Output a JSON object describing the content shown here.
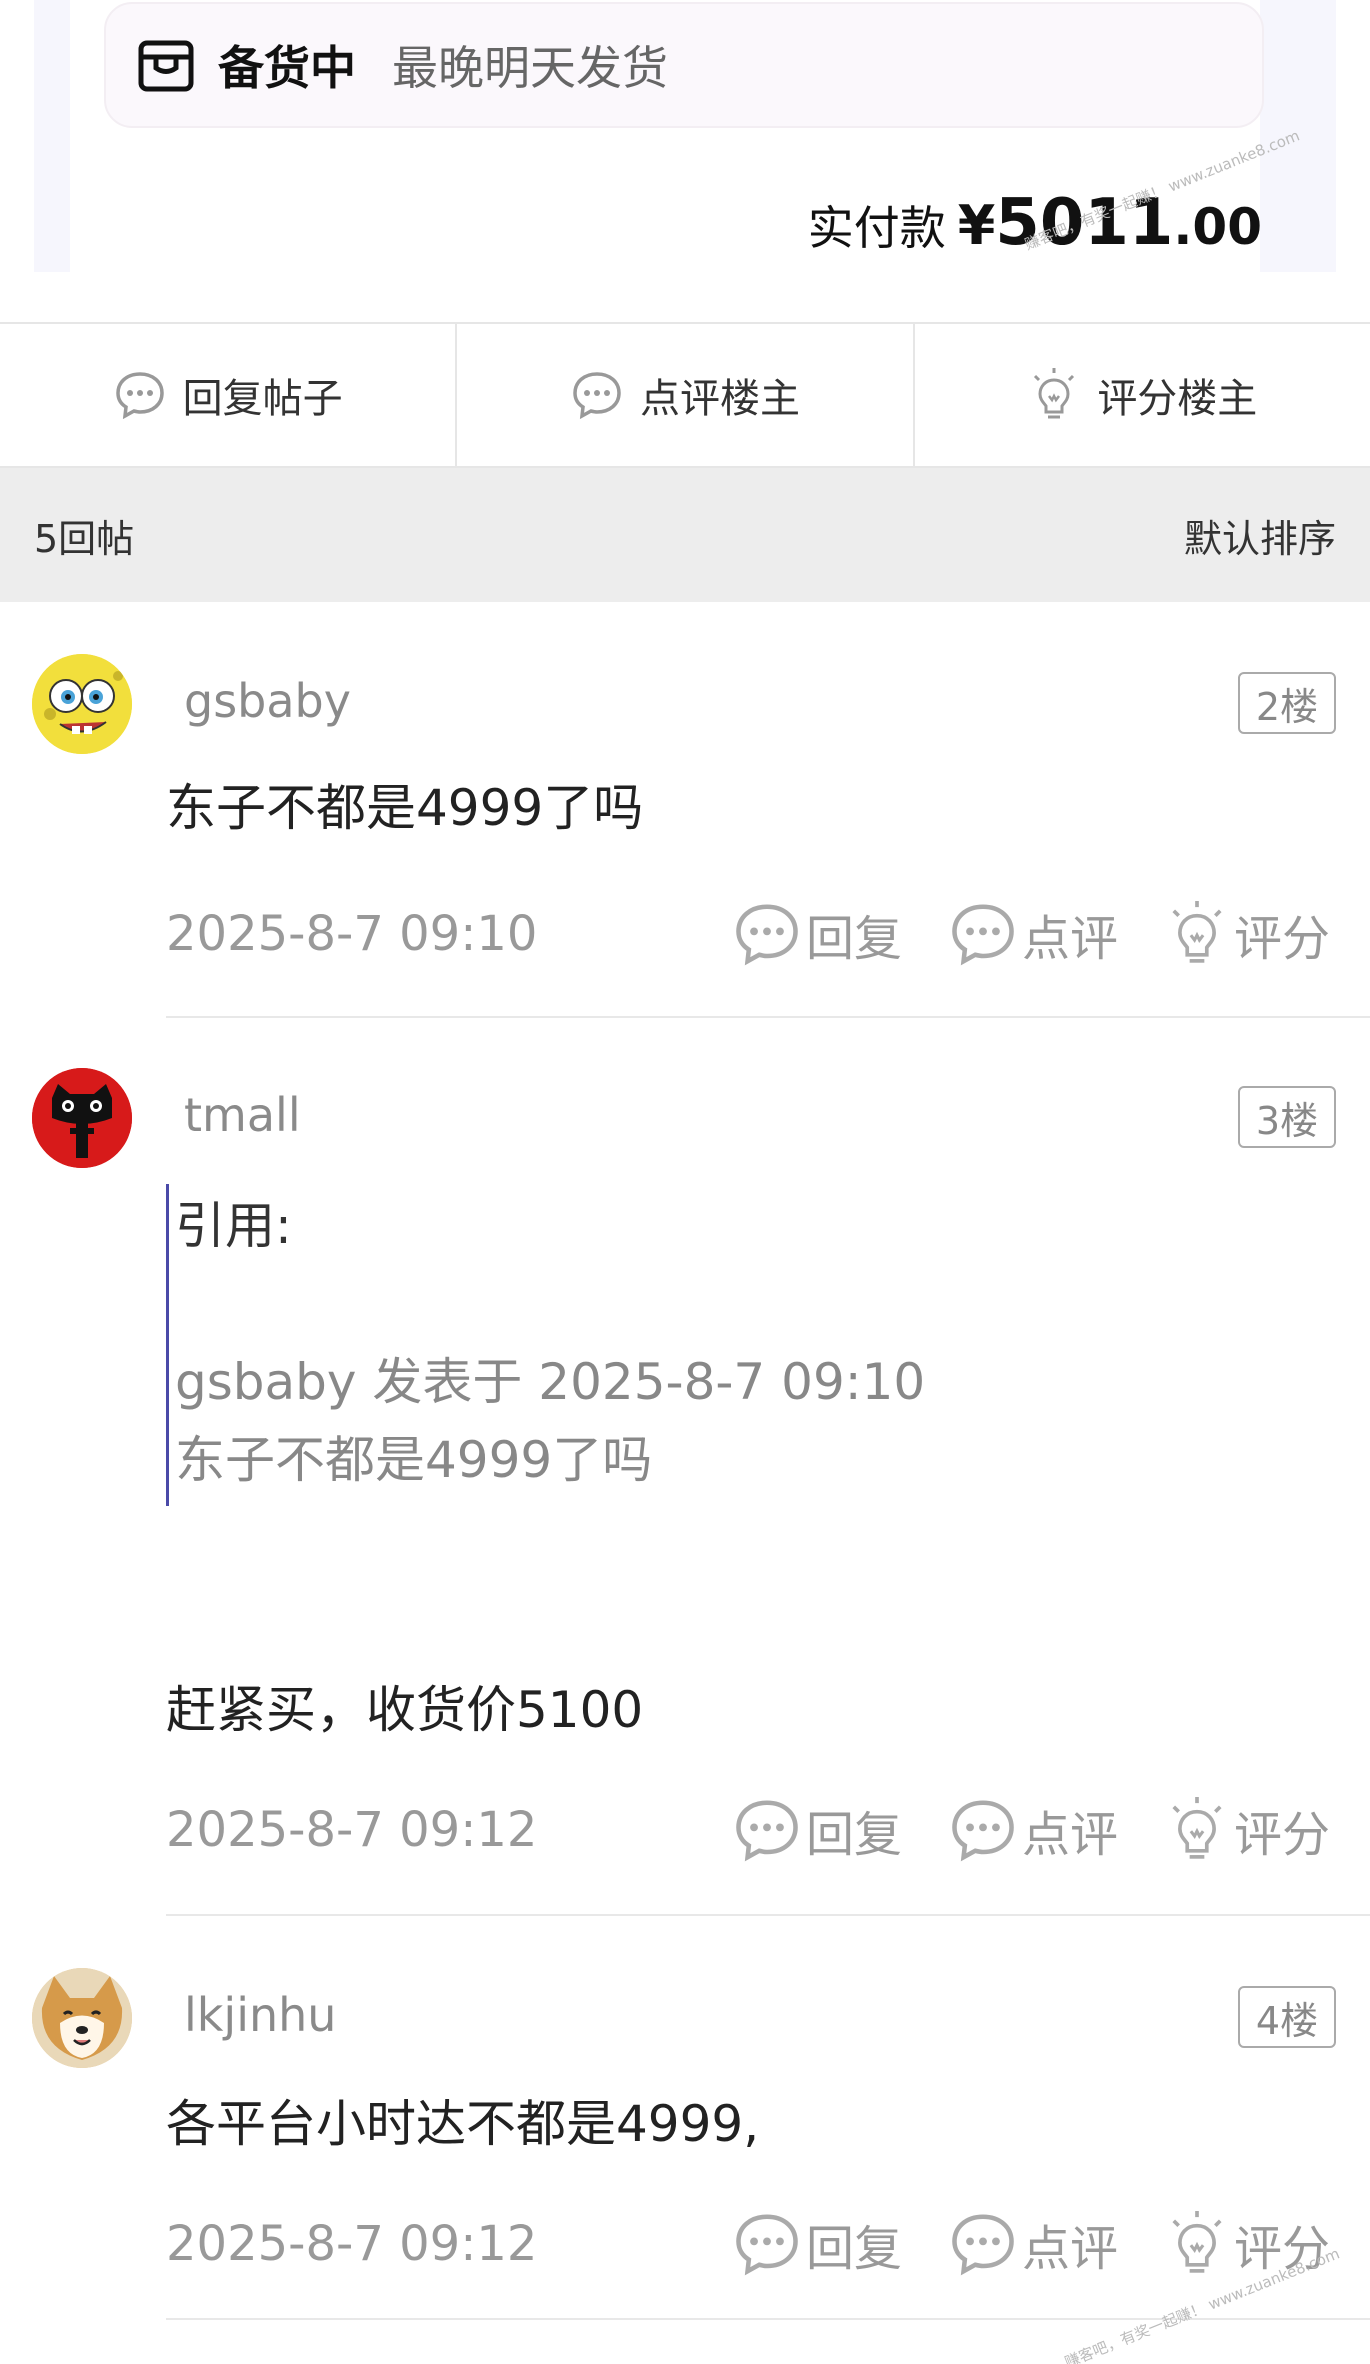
{
  "order": {
    "status_main": "备货中",
    "status_sub": "最晚明天发货",
    "paid_label": "实付款",
    "paid_currency": "¥",
    "paid_integer": "5011",
    "paid_decimal": ".00",
    "watermark": "赚客吧，有奖一起赚！ www.zuanke8.com"
  },
  "actions": [
    {
      "label": "回复帖子",
      "icon": "chat-bubble-icon"
    },
    {
      "label": "点评楼主",
      "icon": "chat-bubble-icon"
    },
    {
      "label": "评分楼主",
      "icon": "lightbulb-icon"
    }
  ],
  "sort_bar": {
    "count": "5回帖",
    "order": "默认排序"
  },
  "posts": [
    {
      "username": "gsbaby",
      "floor": "2楼",
      "content": "东子不都是4999了吗",
      "time": "2025-8-7 09:10",
      "avatar": "spongebob-avatar"
    },
    {
      "username": "tmall",
      "floor": "3楼",
      "quote_label": "引用:",
      "quote_meta": "gsbaby 发表于 2025-8-7 09:10",
      "quote_text": "东子不都是4999了吗",
      "content": "赶紧买，收货价5100",
      "time": "2025-8-7 09:12",
      "avatar": "tmall-cat-avatar"
    },
    {
      "username": "lkjinhu",
      "floor": "4楼",
      "content": "各平台小时达不都是4999,",
      "time": "2025-8-7 09:12",
      "avatar": "shiba-dog-avatar"
    }
  ],
  "post_actions": {
    "reply": "回复",
    "comment": "点评",
    "rate": "评分"
  },
  "colors": {
    "meta_gray": "#999999",
    "quote_bar": "#4a4aa8",
    "sort_bg": "#ededed"
  }
}
